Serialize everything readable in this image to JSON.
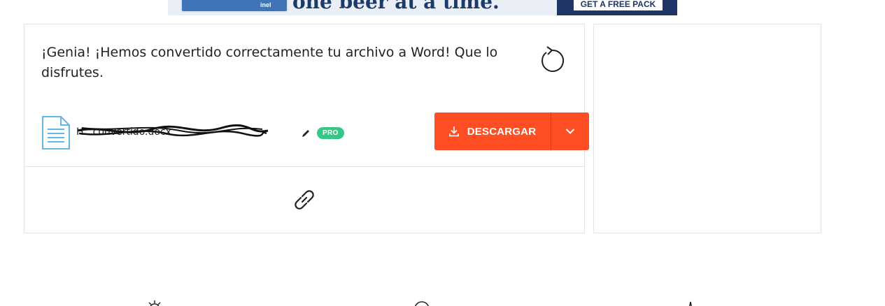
{
  "ad": {
    "product_label": "inel",
    "headline": "one beer at a time.",
    "cta_label": "GET A FREE PACK"
  },
  "result": {
    "message": "¡Genia! ¡Hemos convertido correctamente tu archivo a Word! Que lo disfrutes.",
    "file_name": "H...convertido.docx",
    "badge": "PRO",
    "download_label": "DESCARGAR"
  },
  "icons": {
    "restart": "restart-icon",
    "document": "document-icon",
    "edit": "pencil-icon",
    "download": "download-icon",
    "dropdown": "chevron-down-icon",
    "link": "link-icon"
  },
  "colors": {
    "accent": "#ff4e23",
    "accent_dark": "#d43c17",
    "pro_badge": "#35c785",
    "doc_icon": "#5fb8e6",
    "border": "#e3e3e3"
  }
}
